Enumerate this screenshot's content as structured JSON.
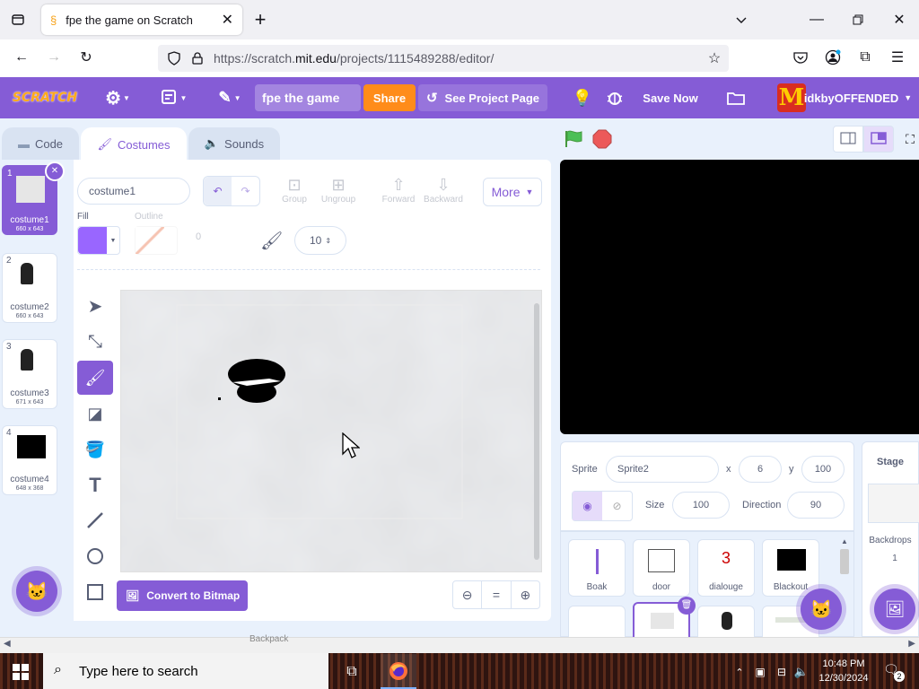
{
  "browser": {
    "tab_title": "fpe the game on Scratch",
    "url_domain": "https://scratch.",
    "url_bold": "mit.edu",
    "url_path": "/projects/1115489288/editor/"
  },
  "menu": {
    "logo": "SCRATCH",
    "project_title": "fpe the game",
    "share_label": "Share",
    "see_project_label": "See Project Page",
    "save_label": "Save Now",
    "username": "idkbyOFFENDED"
  },
  "tabs": {
    "code": "Code",
    "costumes": "Costumes",
    "sounds": "Sounds"
  },
  "costumes": [
    {
      "num": "1",
      "name": "costume1",
      "size": "660 x 643"
    },
    {
      "num": "2",
      "name": "costume2",
      "size": "660 x 643"
    },
    {
      "num": "3",
      "name": "costume3",
      "size": "671 x 643"
    },
    {
      "num": "4",
      "name": "costume4",
      "size": "648 x 368"
    }
  ],
  "paint": {
    "costume_name": "costume1",
    "group": "Group",
    "ungroup": "Ungroup",
    "forward": "Forward",
    "backward": "Backward",
    "more": "More",
    "fill_label": "Fill",
    "outline_label": "Outline",
    "outline_width": "0",
    "brush_size": "10",
    "convert_label": "Convert to Bitmap",
    "fill_color": "#9966ff",
    "zoom_reset": "="
  },
  "sprite_info": {
    "sprite_label": "Sprite",
    "sprite_name": "Sprite2",
    "x_label": "x",
    "x": "6",
    "y_label": "y",
    "y": "100",
    "size_label": "Size",
    "size": "100",
    "direction_label": "Direction",
    "direction": "90"
  },
  "sprites": [
    {
      "name": "Boak"
    },
    {
      "name": "door"
    },
    {
      "name": "dialouge",
      "thumb_text": "3"
    },
    {
      "name": "Blackout"
    }
  ],
  "stage_panel": {
    "title": "Stage",
    "backdrops_label": "Backdrops",
    "backdrops_count": "1"
  },
  "bottom_hint": "Backpack",
  "taskbar": {
    "search_placeholder": "Type here to search",
    "time": "10:48 PM",
    "date": "12/30/2024",
    "notif_count": "2"
  },
  "colors": {
    "scratch_purple": "#855cd6",
    "share_orange": "#ff8c1a",
    "stop_red": "#ec5959",
    "go_green": "#4cbf56"
  }
}
